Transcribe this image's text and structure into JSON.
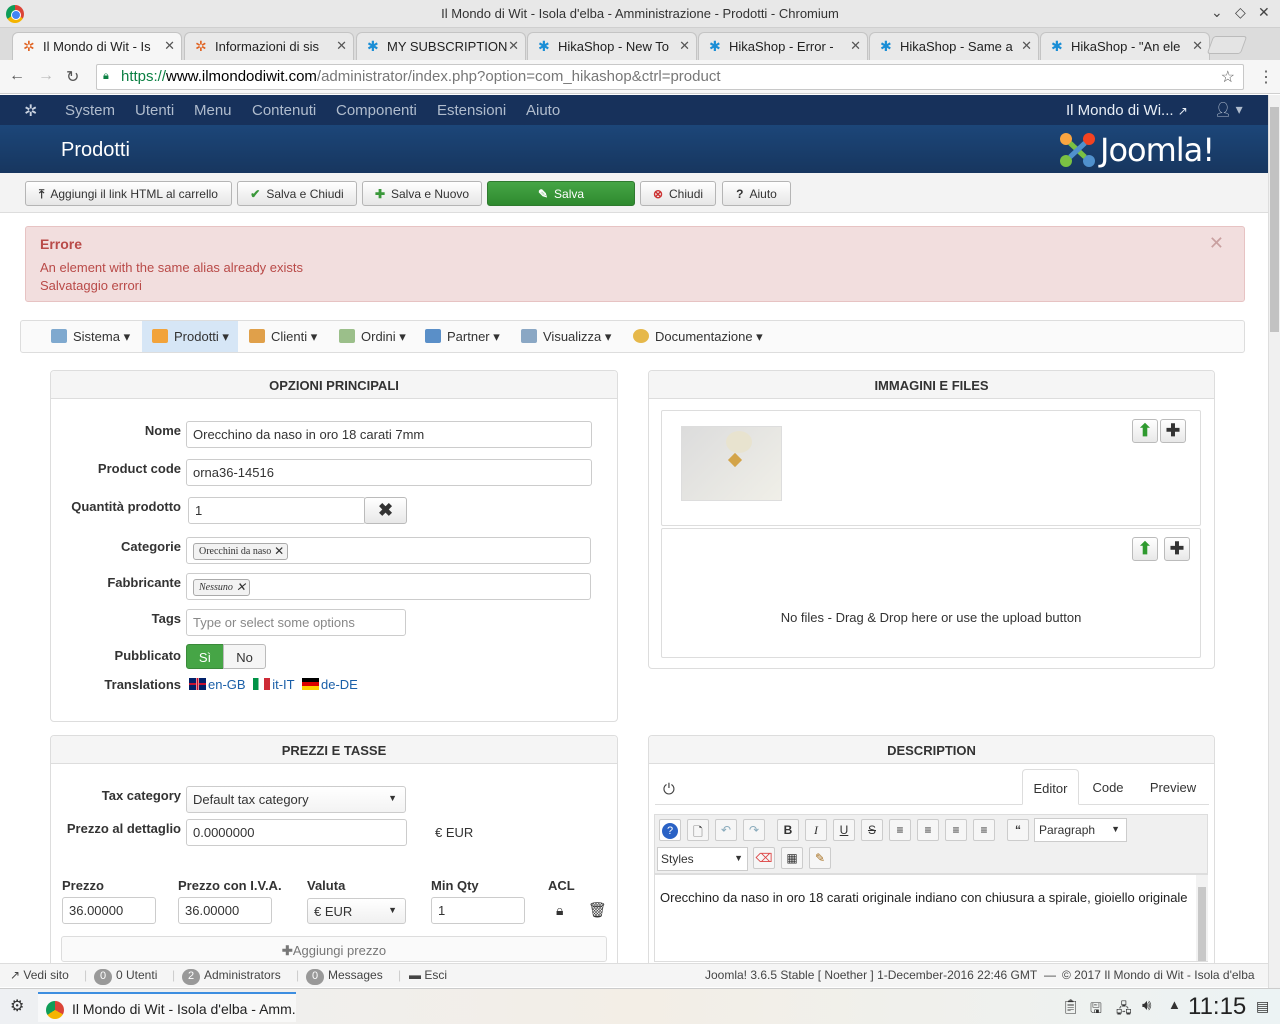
{
  "window": {
    "title": "Il Mondo di Wit - Isola d'elba - Amministrazione - Prodotti - Chromium"
  },
  "tabs": [
    {
      "label": "Il Mondo di Wit - Is"
    },
    {
      "label": "Informazioni di sis"
    },
    {
      "label": "MY SUBSCRIPTION"
    },
    {
      "label": "HikaShop - New To"
    },
    {
      "label": "HikaShop - Error -"
    },
    {
      "label": "HikaShop - Same a"
    },
    {
      "label": "HikaShop - \"An ele"
    }
  ],
  "address": {
    "scheme": "https://",
    "host": "www.ilmondodiwit.com",
    "path": "/administrator/index.php?option=com_hikashop&ctrl=product"
  },
  "jnav": {
    "items": [
      "System",
      "Utenti",
      "Menu",
      "Contenuti",
      "Componenti",
      "Estensioni",
      "Aiuto"
    ],
    "site": "Il Mondo di Wi..."
  },
  "header": {
    "title": "Prodotti",
    "logo": "Joomla!"
  },
  "toolbar": {
    "add_cart": "Aggiungi il link HTML al carrello",
    "save_close": "Salva e Chiudi",
    "save_new": "Salva e Nuovo",
    "save": "Salva",
    "close": "Chiudi",
    "help": "Aiuto"
  },
  "error": {
    "title": "Errore",
    "messages": [
      "An element with the same alias already exists",
      "Salvataggio errori"
    ]
  },
  "hikamenu": [
    {
      "label": "Sistema"
    },
    {
      "label": "Prodotti"
    },
    {
      "label": "Clienti"
    },
    {
      "label": "Ordini"
    },
    {
      "label": "Partner"
    },
    {
      "label": "Visualizza"
    },
    {
      "label": "Documentazione"
    }
  ],
  "main": {
    "title": "OPZIONI PRINCIPALI",
    "name_label": "Nome",
    "name_value": "Orecchino da naso in oro 18 carati 7mm",
    "code_label": "Product code",
    "code_value": "orna36-14516",
    "qty_label": "Quantità prodotto",
    "qty_value": "1",
    "cat_label": "Categorie",
    "cat_chip": "Orecchini da naso",
    "man_label": "Fabbricante",
    "man_chip": "Nessuno",
    "tags_label": "Tags",
    "tags_placeholder": "Type or select some options",
    "pub_label": "Pubblicato",
    "pub_yes": "Sì",
    "pub_no": "No",
    "trans_label": "Translations",
    "translations": [
      "en-GB",
      "it-IT",
      "de-DE"
    ]
  },
  "images": {
    "title": "IMMAGINI E FILES",
    "no_files": "No files - Drag & Drop here or use the upload button"
  },
  "prices": {
    "title": "PREZZI E TASSE",
    "tax_label": "Tax category",
    "tax_value": "Default tax category",
    "retail_label": "Prezzo al dettaglio",
    "retail_value": "0.0000000",
    "retail_currency": "€ EUR",
    "col_price": "Prezzo",
    "col_price_vat": "Prezzo con I.V.A.",
    "col_currency": "Valuta",
    "col_minqty": "Min Qty",
    "col_acl": "ACL",
    "price": "36.00000",
    "price_vat": "36.00000",
    "currency": "€ EUR",
    "minqty": "1",
    "add_price": "Aggiungi prezzo"
  },
  "description": {
    "title": "DESCRIPTION",
    "tabs": [
      "Editor",
      "Code",
      "Preview"
    ],
    "format": "Paragraph",
    "styles": "Styles",
    "text": "Orecchino da naso in oro 18 carati originale indiano con chiusura a spirale, gioiello originale"
  },
  "status": {
    "view_site": "Vedi sito",
    "users_count": "0",
    "users": "0 Utenti",
    "admins_count": "2",
    "admins": "Administrators",
    "msg_count": "0",
    "messages": "Messages",
    "logout": "Esci",
    "version": "Joomla! 3.6.5 Stable [ Noether ] 1-December-2016 22:46 GMT",
    "copyright": "© 2017 Il Mondo di Wit - Isola d'elba"
  },
  "taskbar": {
    "task": "Il Mondo di Wit - Isola d'elba - Amm...",
    "clock": "11:15"
  },
  "colors": {
    "joomla_nav": "#17315b",
    "save_green": "#3a983a",
    "error_bg": "#f2dede",
    "accent_blue": "#1a5fa8"
  }
}
